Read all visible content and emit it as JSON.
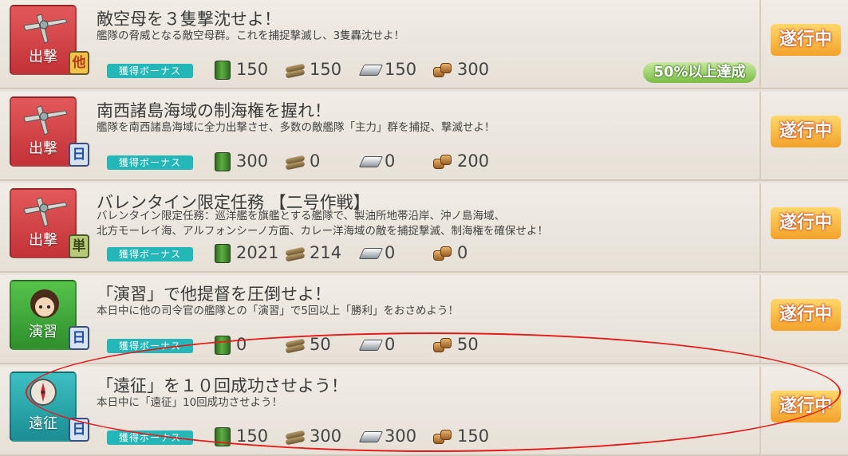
{
  "quests": [
    {
      "category": "出撃",
      "category_type": "sortie",
      "frequency": "他",
      "frequency_type": "other",
      "title": "敵空母を３隻撃沈せよ！",
      "description": [
        "艦隊の脅威となる敵空母群。これを捕捉撃滅し、3隻轟沈せよ！"
      ],
      "bonus_label": "獲得ボーナス",
      "rewards": {
        "fuel": "150",
        "ammo": "150",
        "steel": "150",
        "bauxite": "300"
      },
      "progress_badge": "50%以上達成",
      "status": "遂行中"
    },
    {
      "category": "出撃",
      "category_type": "sortie",
      "frequency": "日",
      "frequency_type": "daily",
      "title": "南西諸島海域の制海権を握れ！",
      "description": [
        "艦隊を南西諸島海域に全力出撃させ、多数の敵艦隊「主力」群を捕捉、撃滅せよ！"
      ],
      "bonus_label": "獲得ボーナス",
      "rewards": {
        "fuel": "300",
        "ammo": "0",
        "steel": "0",
        "bauxite": "200"
      },
      "progress_badge": "",
      "status": "遂行中"
    },
    {
      "category": "出撃",
      "category_type": "sortie",
      "frequency": "単",
      "frequency_type": "once",
      "title": "バレンタイン限定任務 【二号作戦】",
      "description": [
        "バレンタイン限定任務：巡洋艦を旗艦とする艦隊で、製油所地帯沿岸、沖ノ島海域、",
        "北方モーレイ海、アルフォンシーノ方面、カレー洋海域の敵を捕捉撃滅、制海権を確保せよ！"
      ],
      "bonus_label": "獲得ボーナス",
      "rewards": {
        "fuel": "2021",
        "ammo": "214",
        "steel": "0",
        "bauxite": "0"
      },
      "progress_badge": "",
      "status": "遂行中"
    },
    {
      "category": "演習",
      "category_type": "exercise",
      "frequency": "日",
      "frequency_type": "daily",
      "title": "「演習」で他提督を圧倒せよ！",
      "description": [
        "本日中に他の司令官の艦隊との「演習」で5回以上「勝利」をおさめよう！"
      ],
      "bonus_label": "獲得ボーナス",
      "rewards": {
        "fuel": "0",
        "ammo": "50",
        "steel": "0",
        "bauxite": "50"
      },
      "progress_badge": "",
      "status": "遂行中"
    },
    {
      "category": "遠征",
      "category_type": "expedition",
      "frequency": "日",
      "frequency_type": "daily",
      "title": "「遠征」を１０回成功させよう！",
      "description": [
        "本日中に「遠征」10回成功させよう！"
      ],
      "bonus_label": "獲得ボーナス",
      "rewards": {
        "fuel": "150",
        "ammo": "300",
        "steel": "300",
        "bauxite": "150"
      },
      "progress_badge": "",
      "status": "遂行中"
    }
  ],
  "colors": {
    "highlight_circle": "#e51a1a",
    "status_badge": "#f3a22a",
    "bonus_label": "#25b6b8"
  }
}
